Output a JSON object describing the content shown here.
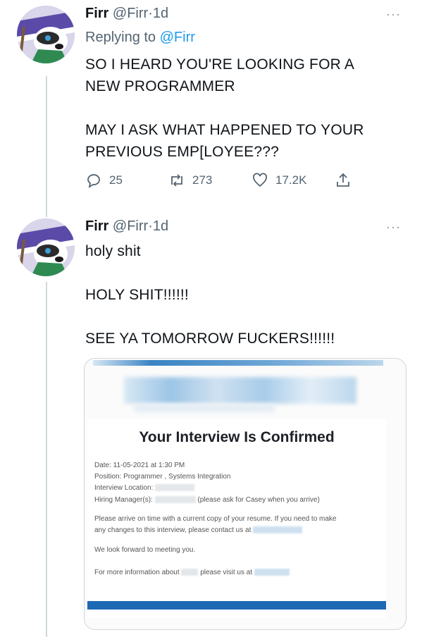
{
  "tweets": [
    {
      "name": "Firr",
      "handle": "@Firr",
      "separator": "·",
      "time": "1d",
      "reply_prefix": "Replying to",
      "reply_to": "@Firr",
      "text": "SO I HEARD YOU'RE LOOKING FOR A\nNEW PROGRAMMER\n\nMAY I ASK WHAT HAPPENED TO YOUR\nPREVIOUS EMP[LOYEE???",
      "actions": {
        "replies": "25",
        "retweets": "273",
        "likes": "17.2K"
      }
    },
    {
      "name": "Firr",
      "handle": "@Firr",
      "separator": "·",
      "time": "1d",
      "text": "holy shit\n\nHOLY SHIT!!!!!!\n\nSEE YA TOMORROW FUCKERS!!!!!!"
    }
  ],
  "more_glyph": "···",
  "email_card": {
    "title": "Your Interview Is Confirmed",
    "date_line": "Date: 11-05-2021 at 1:30 PM",
    "position_line": "Position: Programmer , Systems Integration",
    "location_label": "Interview Location:",
    "hiring_label": "Hiring Manager(s):",
    "hiring_note": "(please ask for Casey when you arrive)",
    "arrive_line1": "Please arrive on time with a current copy of your resume. If you need to make",
    "arrive_line2": "any changes to this interview, please contact us at",
    "forward_line": "We look forward to meeting you.",
    "more_info_prefix": "For more information about",
    "more_info_mid": "please visit us at"
  }
}
